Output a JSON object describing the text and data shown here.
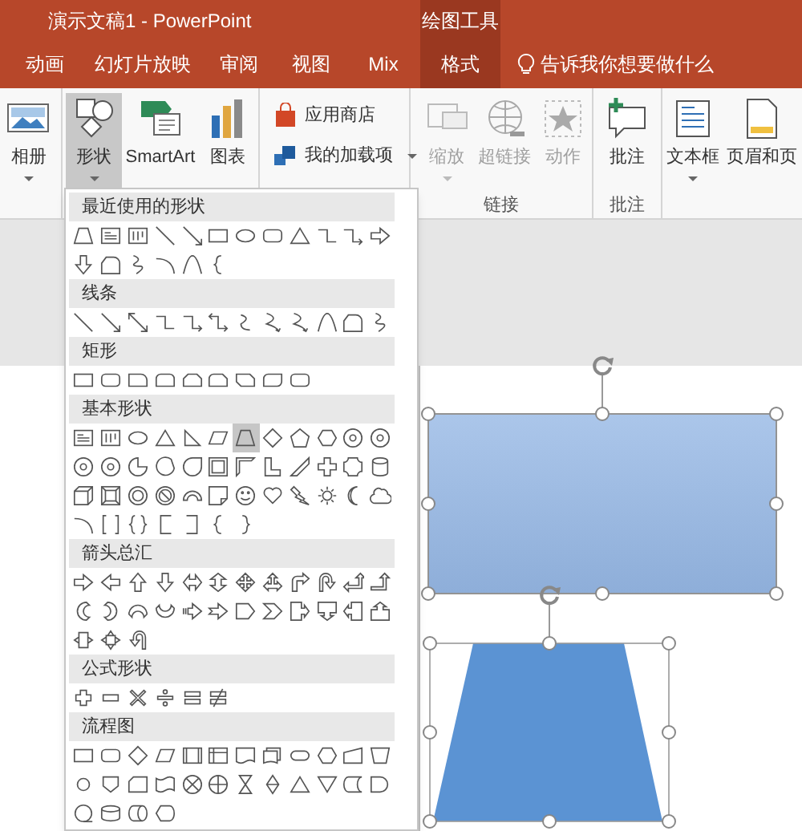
{
  "window": {
    "title": "演示文稿1 - PowerPoint"
  },
  "contextual_tab_group": {
    "label": "绘图工具"
  },
  "tabs": [
    {
      "label": "动画",
      "selected": false
    },
    {
      "label": "幻灯片放映",
      "selected": false
    },
    {
      "label": "审阅",
      "selected": false
    },
    {
      "label": "视图",
      "selected": false
    },
    {
      "label": "Mix",
      "selected": false
    },
    {
      "label": "格式",
      "selected": true
    }
  ],
  "tell_me": {
    "placeholder": "告诉我你想要做什么"
  },
  "ribbon": {
    "groups": [
      {
        "items": [
          {
            "label": "相册",
            "kind": "large",
            "dropdown": true,
            "selected": false,
            "disabled": false
          }
        ]
      },
      {
        "items": [
          {
            "label": "形状",
            "kind": "large",
            "dropdown": true,
            "selected": true,
            "disabled": false
          },
          {
            "label": "SmartArt",
            "kind": "large",
            "dropdown": false,
            "selected": false,
            "disabled": false
          },
          {
            "label": "图表",
            "kind": "large",
            "dropdown": false,
            "selected": false,
            "disabled": false
          }
        ]
      },
      {
        "items": [
          {
            "label": "应用商店",
            "kind": "small",
            "dropdown": false,
            "selected": false,
            "disabled": false
          },
          {
            "label": "我的加载项",
            "kind": "small",
            "dropdown": true,
            "selected": false,
            "disabled": false
          }
        ]
      },
      {
        "label": "链接",
        "items": [
          {
            "label": "缩放",
            "kind": "large",
            "dropdown": true,
            "selected": false,
            "disabled": true
          },
          {
            "label": "超链接",
            "kind": "large",
            "dropdown": false,
            "selected": false,
            "disabled": true
          },
          {
            "label": "动作",
            "kind": "large",
            "dropdown": false,
            "selected": false,
            "disabled": true
          }
        ]
      },
      {
        "label": "批注",
        "items": [
          {
            "label": "批注",
            "kind": "large",
            "dropdown": false,
            "selected": false,
            "disabled": false
          }
        ]
      },
      {
        "items": [
          {
            "label": "文本框",
            "kind": "large",
            "dropdown": true,
            "selected": false,
            "disabled": false
          },
          {
            "label": "页眉和页",
            "kind": "large",
            "dropdown": false,
            "selected": false,
            "disabled": false
          }
        ]
      }
    ]
  },
  "shapes_gallery": {
    "sections": [
      {
        "title": "最近使用的形状",
        "shapes": [
          {
            "kind": "trapezoid",
            "selected": false
          },
          {
            "kind": "textbox",
            "selected": false
          },
          {
            "kind": "vtextbox",
            "selected": false
          },
          {
            "kind": "line",
            "selected": false
          },
          {
            "kind": "arrowline",
            "selected": false
          },
          {
            "kind": "rect",
            "selected": false
          },
          {
            "kind": "ellipse",
            "selected": false
          },
          {
            "kind": "rounded",
            "selected": false
          },
          {
            "kind": "triangle",
            "selected": false
          },
          {
            "kind": "elbow",
            "selected": false
          },
          {
            "kind": "elbowarrow",
            "selected": false
          },
          {
            "kind": "rightarrow",
            "selected": false
          },
          {
            "kind": "downarrow",
            "selected": false
          },
          {
            "kind": "freeform",
            "selected": false
          },
          {
            "kind": "scribble",
            "selected": false
          },
          {
            "kind": "curve",
            "selected": false
          },
          {
            "kind": "wave",
            "selected": false
          },
          {
            "kind": "brace",
            "selected": false
          }
        ]
      },
      {
        "title": "线条",
        "shapes": [
          {
            "kind": "line",
            "selected": false
          },
          {
            "kind": "arrowline",
            "selected": false
          },
          {
            "kind": "dblline",
            "selected": false
          },
          {
            "kind": "elbow",
            "selected": false
          },
          {
            "kind": "elbowarrow",
            "selected": false
          },
          {
            "kind": "elbowdbl",
            "selected": false
          },
          {
            "kind": "scurve",
            "selected": false
          },
          {
            "kind": "curvearrow",
            "selected": false
          },
          {
            "kind": "curvedbl",
            "selected": false
          },
          {
            "kind": "wave",
            "selected": false
          },
          {
            "kind": "freeform",
            "selected": false
          },
          {
            "kind": "scribble",
            "selected": false
          }
        ]
      },
      {
        "title": "矩形",
        "shapes": [
          {
            "kind": "rect",
            "selected": false
          },
          {
            "kind": "rounded",
            "selected": false
          },
          {
            "kind": "round1",
            "selected": false
          },
          {
            "kind": "round2",
            "selected": false
          },
          {
            "kind": "snip2",
            "selected": false
          },
          {
            "kind": "snipround",
            "selected": false
          },
          {
            "kind": "snipdiag",
            "selected": false
          },
          {
            "kind": "rounddiag",
            "selected": false
          },
          {
            "kind": "rounded",
            "selected": false
          }
        ]
      },
      {
        "title": "基本形状",
        "shapes": [
          {
            "kind": "textbox",
            "selected": false
          },
          {
            "kind": "vtextbox",
            "selected": false
          },
          {
            "kind": "ellipse",
            "selected": false
          },
          {
            "kind": "triangle",
            "selected": false
          },
          {
            "kind": "rtriangle",
            "selected": false
          },
          {
            "kind": "parallelogram",
            "selected": false
          },
          {
            "kind": "trapezoid",
            "selected": true
          },
          {
            "kind": "diamond",
            "selected": false
          },
          {
            "kind": "pentagon",
            "selected": false
          },
          {
            "kind": "hexagon",
            "selected": false
          },
          {
            "kind": "heptagon",
            "selected": false
          },
          {
            "kind": "octagon",
            "selected": false
          },
          {
            "kind": "decagon",
            "selected": false
          },
          {
            "kind": "dodecagon",
            "selected": false
          },
          {
            "kind": "pie",
            "selected": false
          },
          {
            "kind": "chord",
            "selected": false
          },
          {
            "kind": "teardrop",
            "selected": false
          },
          {
            "kind": "frame",
            "selected": false
          },
          {
            "kind": "halfframe",
            "selected": false
          },
          {
            "kind": "lshape",
            "selected": false
          },
          {
            "kind": "stripe",
            "selected": false
          },
          {
            "kind": "cross",
            "selected": false
          },
          {
            "kind": "plaque",
            "selected": false
          },
          {
            "kind": "can",
            "selected": false
          },
          {
            "kind": "cube",
            "selected": false
          },
          {
            "kind": "bevel",
            "selected": false
          },
          {
            "kind": "donut",
            "selected": false
          },
          {
            "kind": "nosymbol",
            "selected": false
          },
          {
            "kind": "blockarc",
            "selected": false
          },
          {
            "kind": "fold",
            "selected": false
          },
          {
            "kind": "smiley",
            "selected": false
          },
          {
            "kind": "heart",
            "selected": false
          },
          {
            "kind": "lightning",
            "selected": false
          },
          {
            "kind": "sun",
            "selected": false
          },
          {
            "kind": "moon",
            "selected": false
          },
          {
            "kind": "cloud",
            "selected": false
          },
          {
            "kind": "arc",
            "selected": false
          },
          {
            "kind": "bracketpair",
            "selected": false
          },
          {
            "kind": "bracepair",
            "selected": false
          },
          {
            "kind": "lbracket",
            "selected": false
          },
          {
            "kind": "rbracket",
            "selected": false
          },
          {
            "kind": "brace",
            "selected": false
          },
          {
            "kind": "rbrace",
            "selected": false
          }
        ]
      },
      {
        "title": "箭头总汇",
        "shapes": [
          {
            "kind": "rightarrow",
            "selected": false
          },
          {
            "kind": "leftarrow",
            "selected": false
          },
          {
            "kind": "uparrow",
            "selected": false
          },
          {
            "kind": "downarrow",
            "selected": false
          },
          {
            "kind": "lrarrow",
            "selected": false
          },
          {
            "kind": "udarrow",
            "selected": false
          },
          {
            "kind": "quadarrow",
            "selected": false
          },
          {
            "kind": "lruarrow",
            "selected": false
          },
          {
            "kind": "bentarrow",
            "selected": false
          },
          {
            "kind": "uturn",
            "selected": false
          },
          {
            "kind": "leftuparrow",
            "selected": false
          },
          {
            "kind": "bentuparrow",
            "selected": false
          },
          {
            "kind": "curvedright",
            "selected": false
          },
          {
            "kind": "curvedleft",
            "selected": false
          },
          {
            "kind": "curvedup",
            "selected": false
          },
          {
            "kind": "curveddown",
            "selected": false
          },
          {
            "kind": "stripedarrow",
            "selected": false
          },
          {
            "kind": "notchedarrow",
            "selected": false
          },
          {
            "kind": "pentarrow",
            "selected": false
          },
          {
            "kind": "chevron",
            "selected": false
          },
          {
            "kind": "rightcallout",
            "selected": false
          },
          {
            "kind": "downcallout",
            "selected": false
          },
          {
            "kind": "leftcallout",
            "selected": false
          },
          {
            "kind": "upcallout",
            "selected": false
          },
          {
            "kind": "lrcallout",
            "selected": false
          },
          {
            "kind": "quadcallout",
            "selected": false
          },
          {
            "kind": "circulararrow",
            "selected": false
          }
        ]
      },
      {
        "title": "公式形状",
        "shapes": [
          {
            "kind": "plus",
            "selected": false
          },
          {
            "kind": "minus",
            "selected": false
          },
          {
            "kind": "times",
            "selected": false
          },
          {
            "kind": "divide",
            "selected": false
          },
          {
            "kind": "equal",
            "selected": false
          },
          {
            "kind": "notequal",
            "selected": false
          }
        ]
      },
      {
        "title": "流程图",
        "shapes": [
          {
            "kind": "rect",
            "selected": false
          },
          {
            "kind": "rounded",
            "selected": false
          },
          {
            "kind": "diamond",
            "selected": false
          },
          {
            "kind": "parallelogram",
            "selected": false
          },
          {
            "kind": "predefined",
            "selected": false
          },
          {
            "kind": "internal",
            "selected": false
          },
          {
            "kind": "document",
            "selected": false
          },
          {
            "kind": "multidoc",
            "selected": false
          },
          {
            "kind": "terminator",
            "selected": false
          },
          {
            "kind": "preparation",
            "selected": false
          },
          {
            "kind": "manualinput",
            "selected": false
          },
          {
            "kind": "manualop",
            "selected": false
          },
          {
            "kind": "connector",
            "selected": false
          },
          {
            "kind": "offpage",
            "selected": false
          },
          {
            "kind": "card",
            "selected": false
          },
          {
            "kind": "punchedtape",
            "selected": false
          },
          {
            "kind": "summing",
            "selected": false
          },
          {
            "kind": "or",
            "selected": false
          },
          {
            "kind": "collate",
            "selected": false
          },
          {
            "kind": "sort",
            "selected": false
          },
          {
            "kind": "extract",
            "selected": false
          },
          {
            "kind": "merge",
            "selected": false
          },
          {
            "kind": "storeddata",
            "selected": false
          },
          {
            "kind": "delay",
            "selected": false
          },
          {
            "kind": "seqaccess",
            "selected": false
          },
          {
            "kind": "magdisk",
            "selected": false
          },
          {
            "kind": "directaccess",
            "selected": false
          },
          {
            "kind": "display",
            "selected": false
          }
        ]
      }
    ]
  },
  "slide": {
    "shapes": [
      {
        "kind": "rectangle",
        "selected": true
      },
      {
        "kind": "trapezoid",
        "selected": true
      }
    ]
  }
}
